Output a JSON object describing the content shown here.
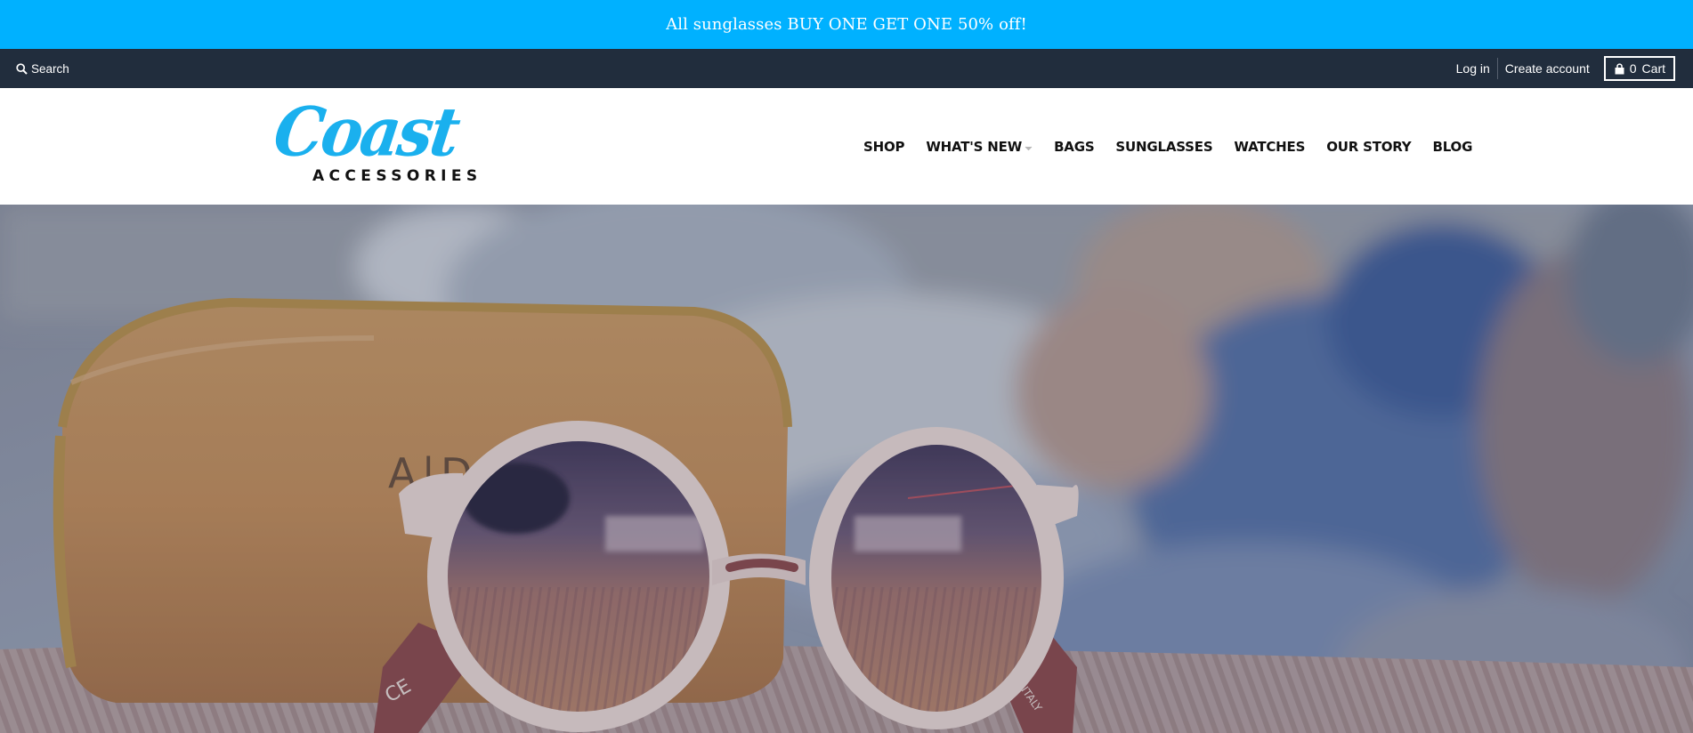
{
  "colors": {
    "announcement_bg": "#00b1ff",
    "utility_bg": "#212d3d",
    "logo_blue": "#1ab0ee",
    "nav_text": "#111111"
  },
  "announcement": {
    "text": "All sunglasses BUY ONE GET ONE 50% off!"
  },
  "utility": {
    "search_label": "Search",
    "search_icon": "search-icon",
    "login_label": "Log in",
    "create_account_label": "Create account",
    "cart_count": "0",
    "cart_label": "Cart",
    "cart_icon": "lock-bag-icon"
  },
  "header": {
    "logo_text": "Coast",
    "logo_subtext": "ACCESSORIES",
    "nav": [
      {
        "label": "SHOP"
      },
      {
        "label": "WHAT'S NEW",
        "has_dropdown": true
      },
      {
        "label": "BAGS"
      },
      {
        "label": "SUNGLASSES"
      },
      {
        "label": "WATCHES"
      },
      {
        "label": "OUR STORY"
      },
      {
        "label": "BLOG"
      }
    ]
  },
  "hero": {
    "case_text": "A|D|O|R|E",
    "temple_left_text": "CE",
    "temple_right_text": "MADE IN ITALY"
  }
}
